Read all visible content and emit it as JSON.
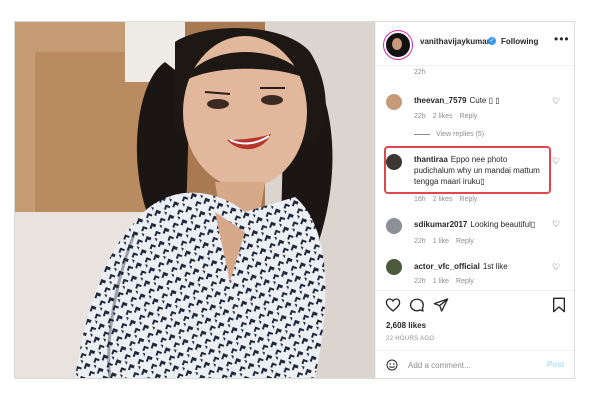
{
  "post": {
    "username": "vanithavijaykumar",
    "follow_status": "Following",
    "more_icon": "•••",
    "verified_mark": "✓",
    "top_time": "22h"
  },
  "comments": [
    {
      "username": "theevan_7579",
      "text": "Cute ▯ ▯",
      "time": "22h",
      "likes": "2 likes",
      "reply": "Reply"
    },
    {
      "username": "thantiraa",
      "text": "Eppo nee photo pudichalum why un mandai mattum tengga maari iruku▯",
      "time": "16h",
      "likes": "2 likes",
      "reply": "Reply"
    },
    {
      "username": "sdikumar2017",
      "text": "Looking beautiful▯",
      "time": "22h",
      "likes": "1 like",
      "reply": "Reply"
    },
    {
      "username": "actor_vfc_official",
      "text": "1st like",
      "time": "22h",
      "likes": "1 like",
      "reply": "Reply"
    }
  ],
  "view_replies": "View replies (5)",
  "likes_count": "2,608 likes",
  "post_time": "22 HOURS AGO",
  "add_comment": {
    "placeholder": "Add a comment...",
    "post_label": "Post"
  },
  "icons": {
    "heart": "♡",
    "comment_icons": [
      "heart-icon",
      "comment-icon",
      "share-icon",
      "bookmark-icon",
      "emoji-icon"
    ]
  },
  "colors": {
    "highlight": "#e0474c",
    "link_blue": "#3897f0",
    "post_disabled": "#b2dffc"
  }
}
